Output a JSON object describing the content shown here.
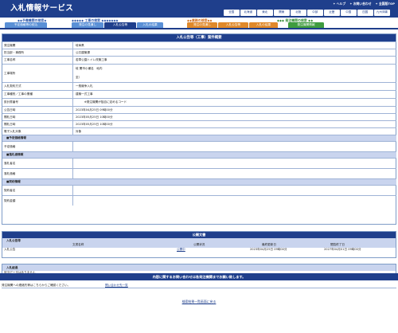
{
  "app": {
    "title": "入札情報サービス"
  },
  "top_links": [
    "✦ ヘルプ",
    "✦ お問い合わせ",
    "✦ 全国版TOP"
  ],
  "regions": [
    "全国",
    "北海道",
    "東北",
    "関東",
    "北陸",
    "中部",
    "近畿",
    "中国",
    "四国",
    "九州沖縄"
  ],
  "categories": [
    {
      "label": "◆◆予備機関の検索◆",
      "color": "#2c56a8"
    },
    {
      "label": "◆◆◆◆◆ 工事の検索 ◆◆◆◆◆◆◆",
      "color": "#2c56a8"
    },
    {
      "label": "◆◆業務の検索◆◆",
      "color": "#cc6a1a"
    },
    {
      "label": "◆◆◆ 発注機関の検索 ◆◆",
      "color": "#2f8a2f"
    }
  ],
  "tabs": [
    {
      "label": "予定価格等の絞込",
      "bg": "#5a90d6"
    },
    {
      "label": "発注の見通し",
      "bg": "#5a90d6"
    },
    {
      "label": "入札公告等",
      "bg": "#1f3f8c"
    },
    {
      "label": "入札の結果",
      "bg": "#5a90d6"
    },
    {
      "label": "発注の見通し",
      "bg": "#e0892a"
    },
    {
      "label": "入札公告等",
      "bg": "#e0892a"
    },
    {
      "label": "入札の結果",
      "bg": "#e0892a"
    },
    {
      "label": "発注機関情報",
      "bg": "#3f9c3f"
    }
  ],
  "main": {
    "title": "入札公告等（工事）案件概要",
    "rows": {
      "r1": {
        "label": "発注機関",
        "value": "岐阜県"
      },
      "r2": {
        "label": "担当部・事務所",
        "value": "公共建築課"
      },
      "r3": {
        "label": "工事名称",
        "value": "若草公園トイレ改築工事"
      },
      "r4": {
        "label": "工事場所",
        "value1": "岐 関市小瀬名　地内",
        "value2": "至）"
      },
      "r5": {
        "label": "入札契約方式",
        "value": "一般競争入札"
      },
      "r6": {
        "label": "工事種別／工事の業種",
        "value": "建築一式工事"
      },
      "r7": {
        "label": "設計書番号",
        "value": "　　　※発注機関が独自に定めるコード"
      },
      "r8": {
        "label": "公告日時",
        "value": "2023年04月25日 09時00分"
      },
      "r9": {
        "label": "開札日時",
        "value": "2023年05月25日 10時00分"
      },
      "r10": {
        "label": "開札日時",
        "value": "2023年05月25日 10時00分"
      },
      "r11": {
        "label": "電子入札対象",
        "value": "対象"
      },
      "s1": {
        "label": "■予定価格情報"
      },
      "r12": {
        "label": "予定価格",
        "value": ""
      },
      "s2": {
        "label": "■落札者情報"
      },
      "r13": {
        "label": "落札者名",
        "value": ""
      },
      "r14": {
        "label": "落札価格",
        "value": ""
      },
      "s3": {
        "label": "■契約情報"
      },
      "r15": {
        "label": "契約者名",
        "value": ""
      },
      "r16": {
        "label": "契約金額",
        "value": ""
      }
    }
  },
  "docs": {
    "title": "公開文書",
    "subtitle": "入札公告等",
    "headers": [
      "文書名称",
      "公開状況",
      "最終更新日",
      "閲覧終了日"
    ],
    "row": {
      "name": "入札公告",
      "status": "公開中",
      "updated": "2023年04月25日 09時00分",
      "end": "2027年04月01日 09時00分"
    }
  },
  "lottery": {
    "title": "入札経過",
    "body": "該当データはありません"
  },
  "contact": {
    "banner": "内容に関するお問い合わせは各発注機関までお願い致します。",
    "text": "発注機関への連絡先等はこちらからご確認ください。",
    "link": "問い合わせ先一覧"
  },
  "back": {
    "label": "検索結果一覧画面に戻る"
  }
}
